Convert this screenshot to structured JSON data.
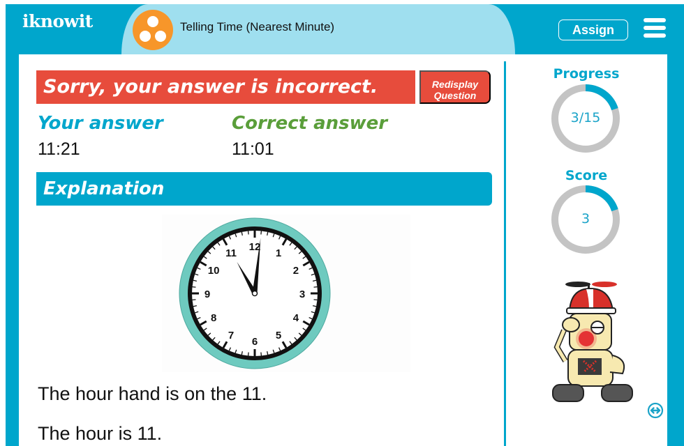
{
  "header": {
    "logo": "iknowit",
    "title": "Telling Time (Nearest Minute)",
    "title_icon": "three-dots-icon",
    "assign_label": "Assign",
    "menu_icon": "hamburger-menu-icon"
  },
  "feedback": {
    "message": "Sorry, your answer is incorrect.",
    "redisplay_line1": "Redisplay",
    "redisplay_line2": "Question"
  },
  "answers": {
    "your_label": "Your answer",
    "your_value": "11:21",
    "correct_label": "Correct answer",
    "correct_value": "11:01"
  },
  "explanation": {
    "heading": "Explanation",
    "clock": {
      "hour": 11,
      "minute": 1,
      "numbers": [
        "12",
        "1",
        "2",
        "3",
        "4",
        "5",
        "6",
        "7",
        "8",
        "9",
        "10",
        "11"
      ]
    },
    "lines": [
      "The hour hand is on the 11.",
      "The hour is 11."
    ]
  },
  "sidebar": {
    "progress": {
      "label": "Progress",
      "text": "3/15",
      "current": 3,
      "total": 15
    },
    "score": {
      "label": "Score",
      "text": "3",
      "fraction": 0.2
    },
    "mascot": "robot-mascot-incorrect",
    "expand_icon": "expand-arrows-icon"
  },
  "colors": {
    "brand": "#00a6cc",
    "light_brand": "#9fdfef",
    "error": "#e74c3c",
    "correct": "#5a9e3a",
    "accent_orange": "#f7962a",
    "ring_gray": "#c4c4c4",
    "clock_rim": "#6ecabf"
  }
}
